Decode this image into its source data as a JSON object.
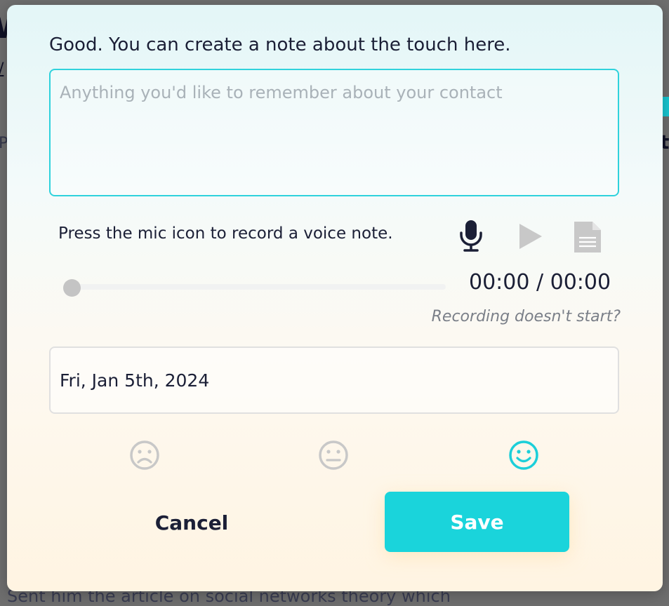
{
  "background": {
    "fragment_w": "W",
    "fragment_slash": "/",
    "fragment_p": "P",
    "fragment_t": "t",
    "bottom_text": "Sent him the article on social networks theory which"
  },
  "modal": {
    "prompt": "Good. You can create a note about the touch here.",
    "note": {
      "value": "",
      "placeholder": "Anything you'd like to remember about your contact"
    },
    "voice": {
      "hint": "Press the mic icon to record a voice note.",
      "icons": [
        "mic-icon",
        "play-icon",
        "document-icon"
      ],
      "time": "00:00 / 00:00",
      "progress": 0,
      "help_link": "Recording doesn't start?"
    },
    "date": "Fri, Jan 5th, 2024",
    "moods": [
      {
        "icon": "sad-face-icon",
        "selected": false,
        "color": "#c8c8c8"
      },
      {
        "icon": "neutral-face-icon",
        "selected": false,
        "color": "#c8c8c8"
      },
      {
        "icon": "happy-face-icon",
        "selected": true,
        "color": "#1ccfd9"
      }
    ],
    "actions": {
      "cancel": "Cancel",
      "save": "Save"
    }
  },
  "colors": {
    "accent": "#1ad4db",
    "text": "#1b1f36",
    "muted": "#a9b2b8"
  }
}
